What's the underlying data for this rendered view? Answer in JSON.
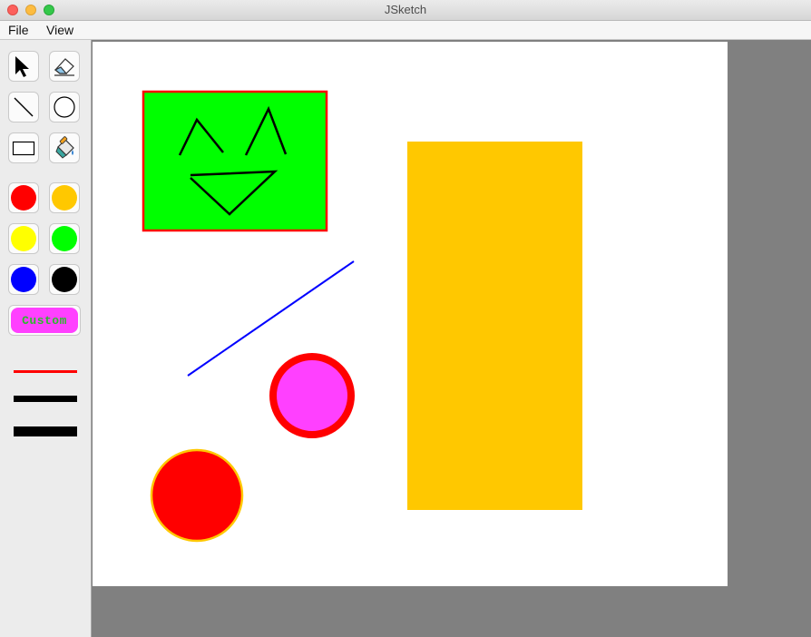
{
  "window": {
    "title": "JSketch"
  },
  "menu": {
    "file": "File",
    "view": "View"
  },
  "tools": {
    "select": "select-tool",
    "erase": "eraser-tool",
    "line": "line-tool",
    "circle": "circle-tool",
    "rect": "rectangle-tool",
    "fill": "fill-tool"
  },
  "palette": {
    "colors": [
      "#ff0000",
      "#ffc800",
      "#ffff00",
      "#00ff00",
      "#0000ff",
      "#000000"
    ],
    "custom_label": "Custom",
    "custom_bg": "#ff40ff",
    "custom_text_color": "#2eb82e"
  },
  "strokes": [
    {
      "color": "#ff0000",
      "weight": "thin"
    },
    {
      "color": "#000000",
      "weight": "medium"
    },
    {
      "color": "#000000",
      "weight": "thick"
    }
  ],
  "canvas": {
    "background": "#ffffff",
    "workspace_bg": "#808080",
    "shapes": [
      {
        "type": "rectangle",
        "fill": "#00ff00",
        "stroke": "#ff0000"
      },
      {
        "type": "freehand-face",
        "stroke": "#000000"
      },
      {
        "type": "rectangle",
        "fill": "#ffc800",
        "stroke": "#ffc800"
      },
      {
        "type": "line",
        "stroke": "#0000ff"
      },
      {
        "type": "circle",
        "fill": "#ff40ff",
        "stroke": "#ff0000"
      },
      {
        "type": "circle",
        "fill": "#ff0000",
        "stroke": "#ffc800"
      }
    ]
  }
}
